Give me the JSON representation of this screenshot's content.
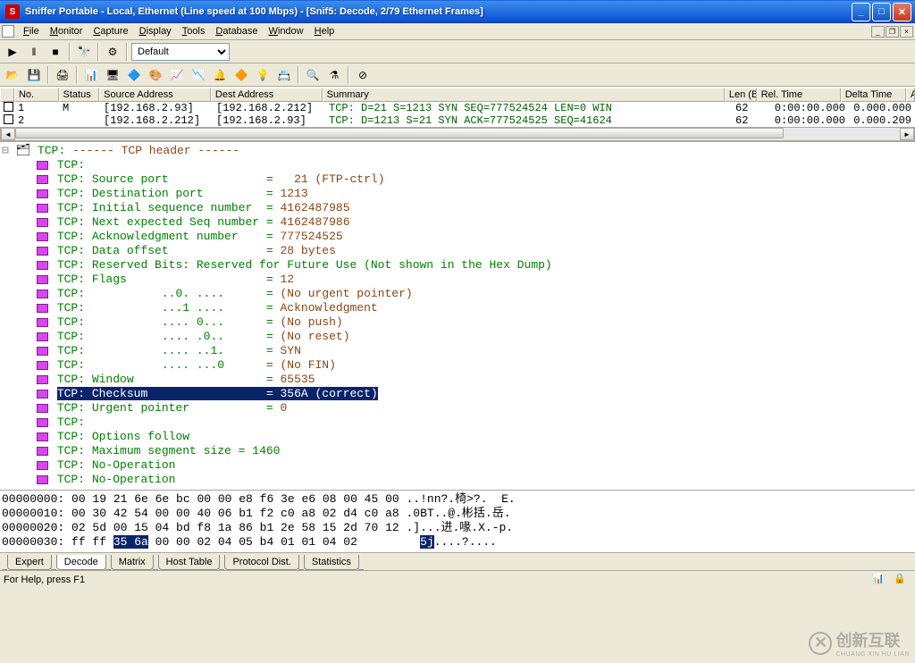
{
  "window": {
    "title": "Sniffer Portable - Local, Ethernet (Line speed at 100 Mbps) - [Snif5: Decode, 2/79 Ethernet Frames]",
    "app_icon_letter": "S"
  },
  "menu": {
    "items": [
      "File",
      "Monitor",
      "Capture",
      "Display",
      "Tools",
      "Database",
      "Window",
      "Help"
    ]
  },
  "toolbar1": {
    "combo_default": "Default"
  },
  "grid": {
    "headers": {
      "no": "No.",
      "status": "Status",
      "src": "Source Address",
      "dest": "Dest Address",
      "summary": "Summary",
      "len": "Len (B",
      "rel": "Rel. Time",
      "delta": "Delta Time",
      "abs": "Abs. Time"
    },
    "rows": [
      {
        "no": "1",
        "status": "M",
        "src": "[192.168.2.93]",
        "dest": "[192.168.2.212]",
        "summary": "TCP: D=21 S=1213 SYN SEQ=777524524 LEN=0 WIN",
        "len": "62",
        "rel": "0:00:00.000",
        "delta": "0.000.000"
      },
      {
        "no": "2",
        "status": "",
        "src": "[192.168.2.212]",
        "dest": "[192.168.2.93]",
        "summary": "TCP: D=1213 S=21 SYN ACK=777524525 SEQ=41624",
        "len": "62",
        "rel": "0:00:00.000",
        "delta": "0.000.209"
      }
    ]
  },
  "decode": {
    "lines": [
      {
        "text": "TCP: ------ TCP header ------",
        "indent": 0,
        "exp": "-",
        "key": "TCP:",
        "val": "------ TCP header ------"
      },
      {
        "key": "TCP:",
        "val": "",
        "indent": 1
      },
      {
        "key": "TCP: Source port",
        "eq": "=",
        "val": "   21 (FTP-ctrl)",
        "indent": 1
      },
      {
        "key": "TCP: Destination port",
        "eq": "=",
        "val": " 1213",
        "indent": 1
      },
      {
        "key": "TCP: Initial sequence number",
        "eq": "=",
        "val": " 4162487985",
        "indent": 1
      },
      {
        "key": "TCP: Next expected Seq number",
        "eq": "=",
        "val": " 4162487986",
        "indent": 1
      },
      {
        "key": "TCP: Acknowledgment number",
        "eq": "=",
        "val": " 777524525",
        "indent": 1
      },
      {
        "key": "TCP: Data offset",
        "eq": "=",
        "val": " 28 bytes",
        "indent": 1
      },
      {
        "key": "TCP: Reserved Bits: Reserved for Future Use (Not shown in the Hex Dump)",
        "indent": 1
      },
      {
        "key": "TCP: Flags",
        "eq": "=",
        "val": " 12",
        "indent": 1
      },
      {
        "key": "TCP:           ..0. ....",
        "eq": "=",
        "val": " (No urgent pointer)",
        "indent": 1
      },
      {
        "key": "TCP:           ...1 ....",
        "eq": "=",
        "val": " Acknowledgment",
        "indent": 1
      },
      {
        "key": "TCP:           .... 0...",
        "eq": "=",
        "val": " (No push)",
        "indent": 1
      },
      {
        "key": "TCP:           .... .0..",
        "eq": "=",
        "val": " (No reset)",
        "indent": 1
      },
      {
        "key": "TCP:           .... ..1.",
        "eq": "=",
        "val": " SYN",
        "indent": 1
      },
      {
        "key": "TCP:           .... ...0",
        "eq": "=",
        "val": " (No FIN)",
        "indent": 1
      },
      {
        "key": "TCP: Window",
        "eq": "=",
        "val": " 65535",
        "indent": 1
      },
      {
        "key": "TCP: Checksum",
        "eq": "=",
        "val": " 356A (correct)",
        "indent": 1,
        "highlight": true
      },
      {
        "key": "TCP: Urgent pointer",
        "eq": "=",
        "val": " 0",
        "indent": 1
      },
      {
        "key": "TCP:",
        "val": "",
        "indent": 1
      },
      {
        "key": "TCP: Options follow",
        "indent": 1
      },
      {
        "key": "TCP: Maximum segment size = 1460",
        "indent": 1
      },
      {
        "key": "TCP: No-Operation",
        "indent": 1
      },
      {
        "key": "TCP: No-Operation",
        "indent": 1
      }
    ]
  },
  "hex": {
    "lines": [
      {
        "addr": "00000000:",
        "data": " 00 19 21 6e 6e bc 00 00 e8 f6 3e e6 08 00 45 00 ",
        "ascii": "..!nn?.椅>?.  E."
      },
      {
        "addr": "00000010:",
        "data": " 00 30 42 54 00 00 40 06 b1 f2 c0 a8 02 d4 c0 a8 ",
        "ascii": ".0BT..@.彬括.岳."
      },
      {
        "addr": "00000020:",
        "data": " 02 5d 00 15 04 bd f8 1a 86 b1 2e 58 15 2d 70 12 ",
        "ascii": ".]...进.喙.X.-p."
      },
      {
        "addr": "00000030:",
        "data": " ff ff ",
        "hl": "35 6a",
        "data2": " 00 00 02 04 05 b4 01 01 04 02       ",
        "ascii": "  ",
        "asciihl": "5j",
        "ascii2": "....?...."
      }
    ]
  },
  "tabs": {
    "items": [
      "Expert",
      "Decode",
      "Matrix",
      "Host Table",
      "Protocol Dist.",
      "Statistics"
    ],
    "active": 1
  },
  "statusbar": {
    "text": "For Help, press F1"
  },
  "watermark": {
    "text": "创新互联",
    "sub": "CHUANG XIN HU LIAN"
  }
}
